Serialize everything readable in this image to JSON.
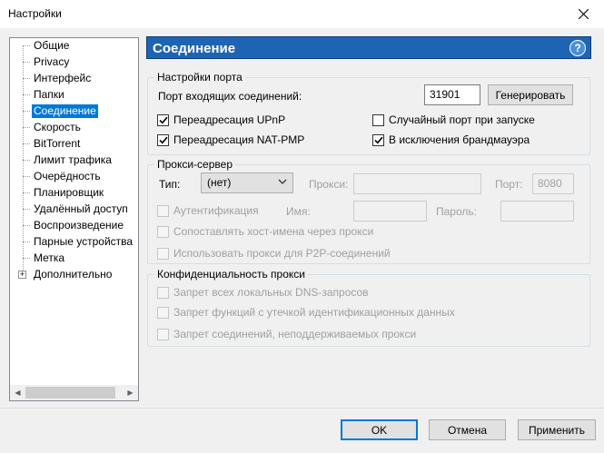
{
  "window": {
    "title": "Настройки"
  },
  "tree": {
    "items": [
      {
        "label": "Общие"
      },
      {
        "label": "Privacy"
      },
      {
        "label": "Интерфейс"
      },
      {
        "label": "Папки"
      },
      {
        "label": "Соединение",
        "selected": true
      },
      {
        "label": "Скорость"
      },
      {
        "label": "BitTorrent"
      },
      {
        "label": "Лимит трафика"
      },
      {
        "label": "Очерёдность"
      },
      {
        "label": "Планировщик"
      },
      {
        "label": "Удалённый доступ"
      },
      {
        "label": "Воспроизведение"
      },
      {
        "label": "Парные устройства"
      },
      {
        "label": "Метка"
      },
      {
        "label": "Дополнительно",
        "expander": "+"
      }
    ]
  },
  "header": {
    "title": "Соединение",
    "help": "?"
  },
  "port_settings": {
    "title": "Настройки порта",
    "incoming_label": "Порт входящих соединений:",
    "incoming_value": "31901",
    "generate_label": "Генерировать",
    "upnp_label": "Переадресация UPnP",
    "upnp_checked": true,
    "natpmp_label": "Переадресация NAT-PMP",
    "natpmp_checked": true,
    "random_port_label": "Случайный порт при запуске",
    "random_port_checked": false,
    "firewall_label": "В исключения брандмауэра",
    "firewall_checked": true
  },
  "proxy": {
    "title": "Прокси-сервер",
    "type_label": "Тип:",
    "type_value": "(нет)",
    "proxy_label": "Прокси:",
    "proxy_value": "",
    "port_label": "Порт:",
    "port_value": "8080",
    "auth_label": "Аутентификация",
    "username_label": "Имя:",
    "password_label": "Пароль:",
    "resolve_label": "Сопоставлять хост-имена через прокси",
    "p2p_label": "Использовать прокси для P2P-соединений"
  },
  "privacy": {
    "title": "Конфиденциальность прокси",
    "dns_label": "Запрет всех локальных DNS-запросов",
    "leak_label": "Запрет функций с утечкой идентификационных данных",
    "unsupported_label": "Запрет соединений, неподдерживаемых прокси"
  },
  "buttons": {
    "ok": "OK",
    "cancel": "Отмена",
    "apply": "Применить"
  }
}
